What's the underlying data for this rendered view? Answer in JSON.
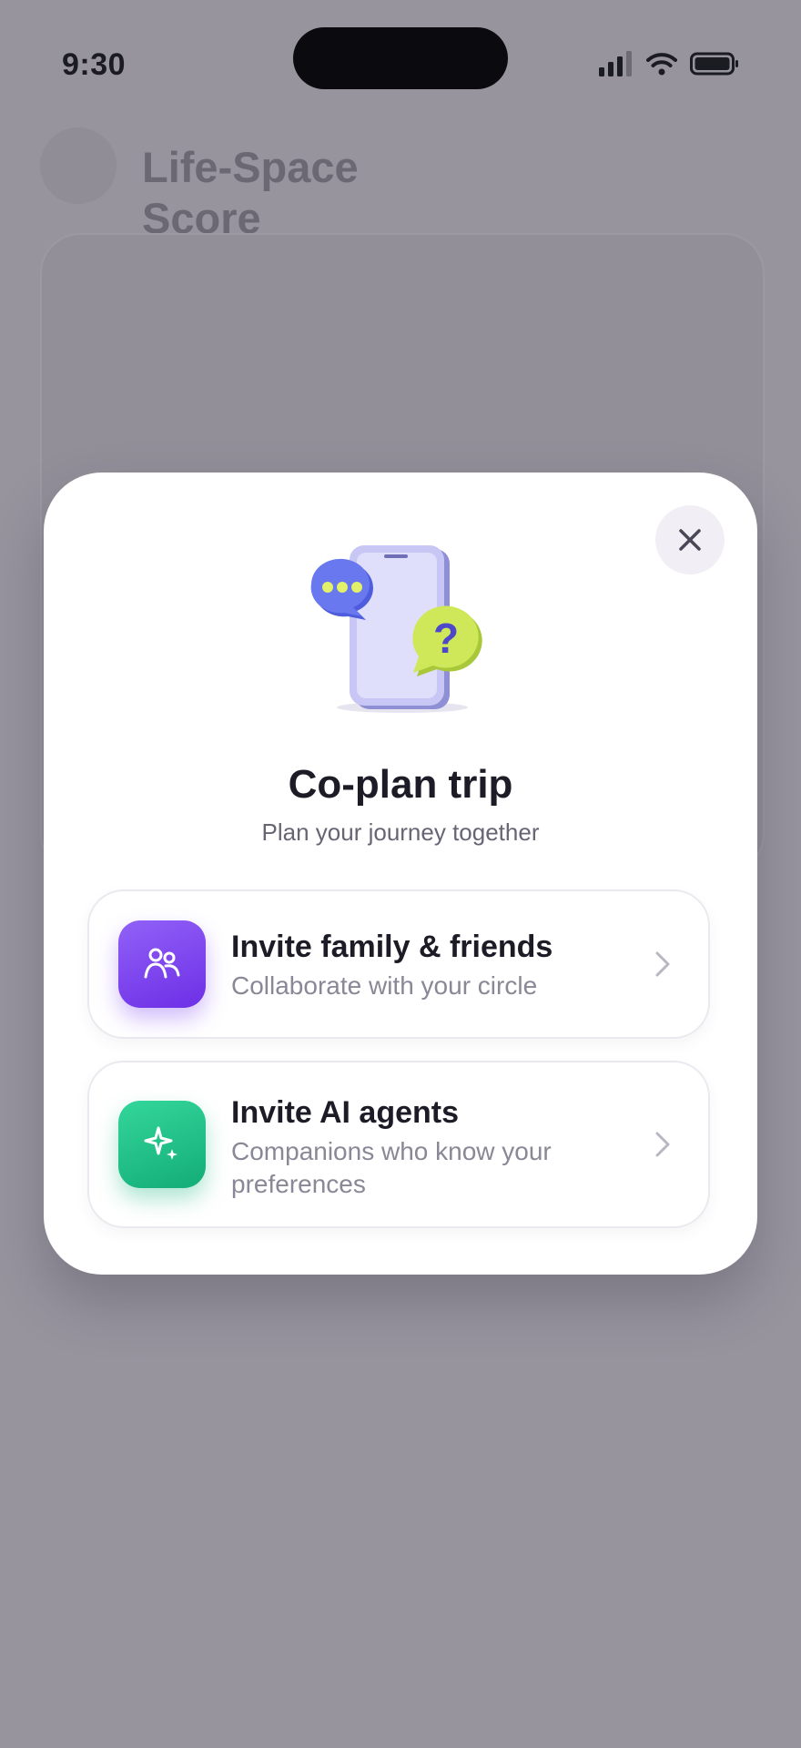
{
  "status_bar": {
    "time": "9:30"
  },
  "background": {
    "title": "Life-Space Score"
  },
  "modal": {
    "title": "Co-plan trip",
    "subtitle": "Plan your journey together",
    "options": [
      {
        "title": "Invite family & friends",
        "description": "Collaborate with your circle",
        "icon": "people-icon",
        "color": "#7c3aed"
      },
      {
        "title": "Invite AI agents",
        "description": "Companions who know your preferences",
        "icon": "sparkles-icon",
        "color": "#10b981"
      }
    ]
  },
  "colors": {
    "overlay": "#97949e",
    "purple": "#7c3aed",
    "green": "#10b981"
  }
}
